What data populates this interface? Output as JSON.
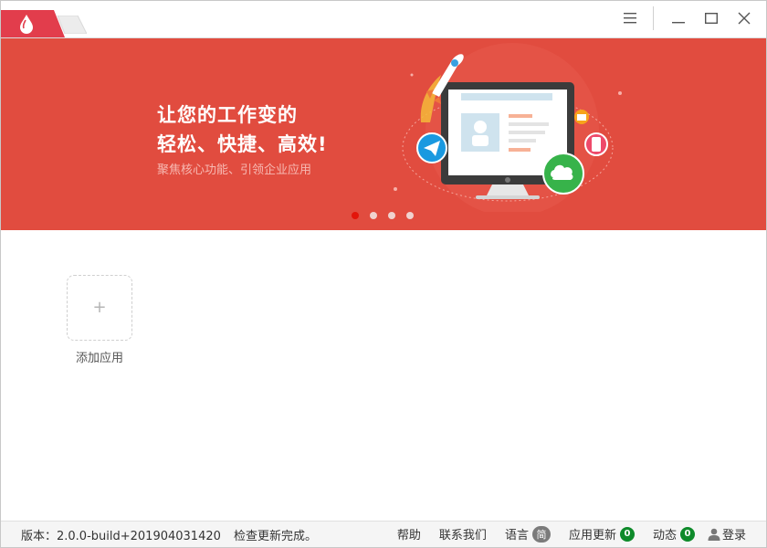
{
  "titlebar": {
    "icons": {
      "logo": "drop-logo-icon",
      "menu": "hamburger-menu-icon",
      "minimize": "minimize-icon",
      "maximize": "maximize-icon",
      "close": "close-icon"
    },
    "colors": {
      "tab_active": "#e23d4c",
      "tab_inactive": "#ececec"
    }
  },
  "banner": {
    "title_line1": "让您的工作变的",
    "title_line2": "轻松、快捷、高效!",
    "subtitle": "聚焦核心功能、引领企业应用",
    "background": "#e14c3f",
    "dot_count": 4,
    "active_dot": 0
  },
  "content": {
    "add_app_icon": "plus-icon",
    "add_app_label": "添加应用"
  },
  "statusbar": {
    "version": "版本：2.0.0-build+201904031420",
    "update_status": "检查更新完成。",
    "help": "帮助",
    "contact": "联系我们",
    "language": "语言",
    "language_badge": "简",
    "app_update": "应用更新",
    "app_update_count": "0",
    "activity": "动态",
    "activity_count": "0",
    "login": "登录",
    "badge_color": "#0e8a2a"
  }
}
